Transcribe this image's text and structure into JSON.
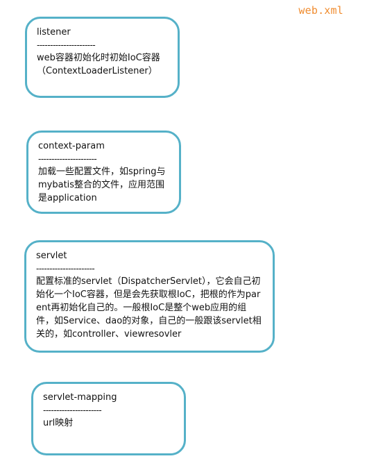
{
  "file_label": "web.xml",
  "separator": "----------------------",
  "nodes": {
    "listener": {
      "title": "listener",
      "description": "web容器初始化时初始IoC容器（ContextLoaderListener）"
    },
    "context_param": {
      "title": "context-param",
      "description": "加载一些配置文件，如spring与mybatis整合的文件，应用范围是application"
    },
    "servlet": {
      "title": "servlet",
      "description": "配置标准的servlet（DispatcherServlet），它会自己初始化一个IoC容器，但是会先获取根IoC，把根的作为parent再初始化自己的。一般根IoC是整个web应用的组件，如Service、dao的对象，自己的一般跟该servlet相关的，如controller、viewresovler"
    },
    "servlet_mapping": {
      "title": "servlet-mapping",
      "description": "url映射"
    }
  },
  "colors": {
    "box_border": "#55b1c8",
    "file_label": "#f08c2f",
    "text": "#111111"
  }
}
